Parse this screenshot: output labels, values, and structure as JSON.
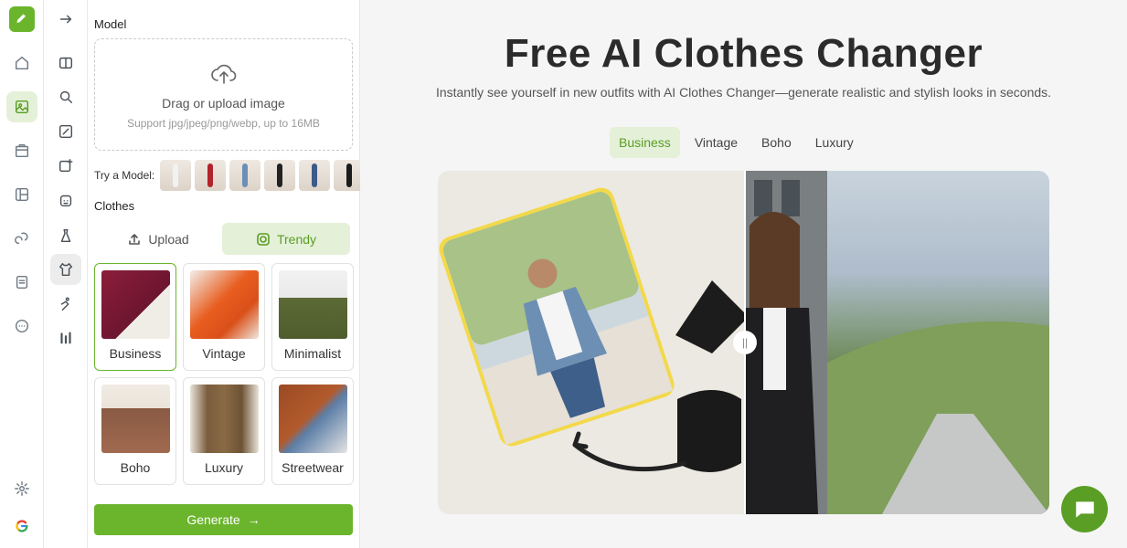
{
  "panel": {
    "model_label": "Model",
    "upload_title": "Drag or upload image",
    "upload_hint": "Support jpg/jpeg/png/webp, up to 16MB",
    "try_model_label": "Try a Model:",
    "clothes_label": "Clothes",
    "tabs": [
      {
        "label": "Upload",
        "icon": "upload-icon"
      },
      {
        "label": "Trendy",
        "icon": "trendy-icon"
      }
    ],
    "styles": [
      {
        "label": "Business"
      },
      {
        "label": "Vintage"
      },
      {
        "label": "Minimalist"
      },
      {
        "label": "Boho"
      },
      {
        "label": "Luxury"
      },
      {
        "label": "Streetwear"
      }
    ],
    "generate_label": "Generate",
    "generate_arrow": "→"
  },
  "main": {
    "title": "Free AI Clothes Changer",
    "subtitle": "Instantly see yourself in new outfits with AI Clothes Changer—generate realistic and stylish looks in seconds.",
    "category_tabs": [
      "Business",
      "Vintage",
      "Boho",
      "Luxury"
    ],
    "compare_handle": "||"
  },
  "colors": {
    "accent": "#6bb52c",
    "accent_light": "#e4f0d8"
  }
}
